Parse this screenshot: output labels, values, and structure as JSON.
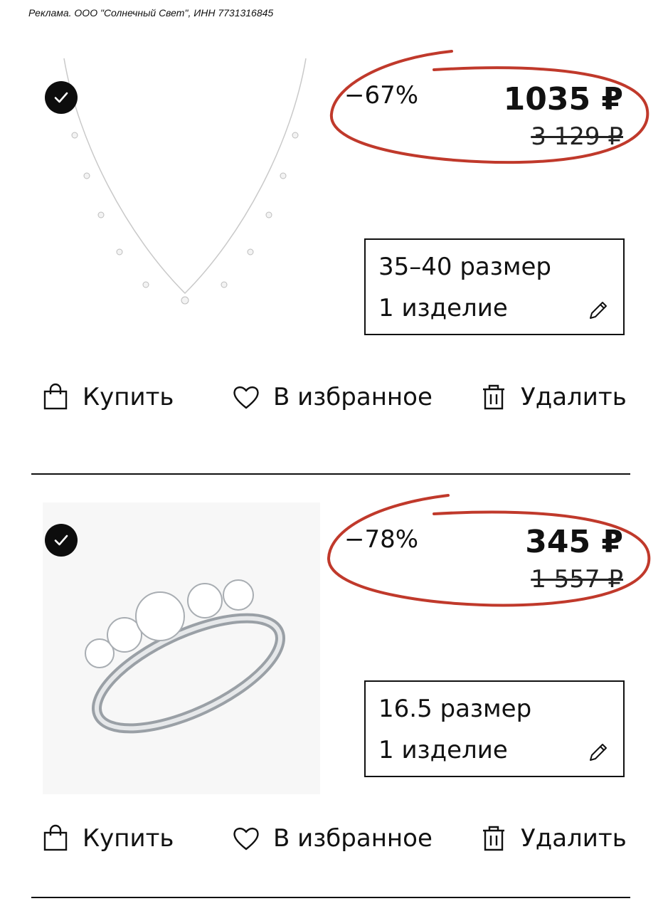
{
  "ad_disclaimer": {
    "text": "Реклама. ООО \"Солнечный Свет\", ИНН 7731316845"
  },
  "accent_colors": {
    "circle_stroke": "#c0392b",
    "check_bg": "#0d0d0d",
    "text": "#111111"
  },
  "products": [
    {
      "image_icon": "necklace-image",
      "selected": true,
      "discount": "−67%",
      "price": "1035 ₽",
      "old_price": "3 129 ₽",
      "size": "35–40 размер",
      "quantity": "1 изделие",
      "actions": {
        "buy": "Купить",
        "favorite": "В избранное",
        "delete": "Удалить"
      }
    },
    {
      "image_icon": "ring-image",
      "selected": true,
      "discount": "−78%",
      "price": "345 ₽",
      "old_price": "1 557 ₽",
      "size": "16.5 размер",
      "quantity": "1 изделие",
      "actions": {
        "buy": "Купить",
        "favorite": "В избранное",
        "delete": "Удалить"
      }
    }
  ]
}
